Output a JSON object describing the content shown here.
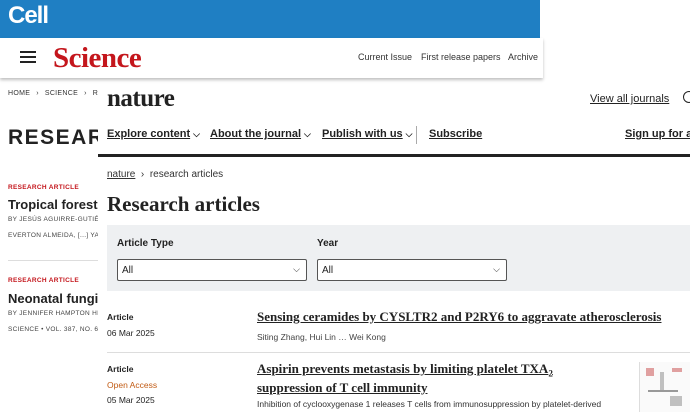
{
  "cell": {
    "logo": "Cell"
  },
  "science": {
    "logo": "Science",
    "nav": [
      "Current Issue",
      "First release papers",
      "Archive"
    ],
    "breadcrumb": [
      "HOME",
      "SCIENCE",
      "RESE"
    ],
    "page_title": "RESEARC",
    "articles": [
      {
        "category": "RESEARCH ARTICLE",
        "title": "Tropical forests",
        "byline": "BY JESÚS AGUIRRE-GUTIÉRRE",
        "meta": "EVERTON ALMEIDA,   [...] YADV"
      },
      {
        "category": "RESEARCH ARTICLE",
        "title": "Neonatal fungi p",
        "byline": "BY JENNIFER HAMPTON HILL,",
        "meta": "SCIENCE  •  VOL. 387, NO. 67:"
      }
    ]
  },
  "nature": {
    "logo": "nature",
    "view_all": "View all journals",
    "nav": {
      "explore": "Explore content",
      "about": "About the journal",
      "publish": "Publish with us",
      "subscribe": "Subscribe",
      "signup": "Sign up for al"
    },
    "breadcrumb": {
      "home": "nature",
      "current": "research articles"
    },
    "page_title": "Research articles",
    "filters": {
      "article_type_label": "Article Type",
      "article_type_value": "All",
      "year_label": "Year",
      "year_value": "All"
    },
    "articles": [
      {
        "type": "Article",
        "date": "06 Mar 2025",
        "title": "Sensing ceramides by CYSLTR2 and P2RY6 to aggravate atherosclerosis",
        "authors": "Siting Zhang, Hui Lin … Wei Kong"
      },
      {
        "type": "Article",
        "access": "Open Access",
        "date": "05 Mar 2025",
        "title_line1": "Aspirin prevents metastasis by limiting platelet TXA",
        "title_sub": "2",
        "title_line2": "suppression of T cell immunity",
        "abstract": "Inhibition of cyclooxygenase 1 releases T cells from immunosuppression by platelet-derived"
      }
    ]
  },
  "colors": {
    "cell_blue": "#1f7fc3",
    "science_red": "#c4161c",
    "open_access": "#c25b14",
    "filter_bg": "#eef0f2"
  }
}
